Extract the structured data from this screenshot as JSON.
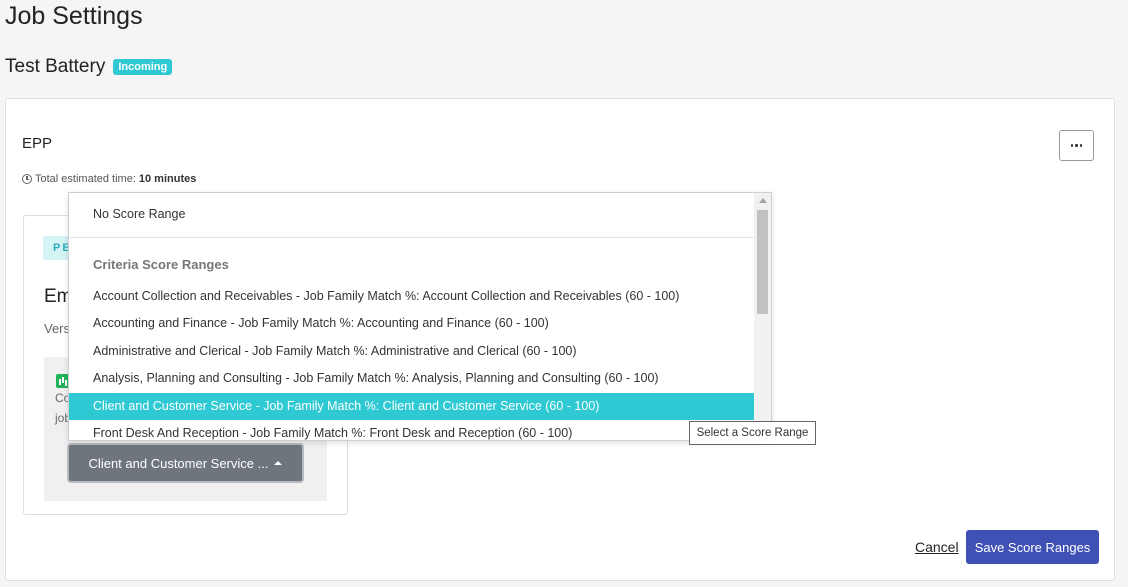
{
  "page": {
    "title": "Job Settings"
  },
  "battery": {
    "title": "Test Battery",
    "badge": "Incoming"
  },
  "assessment": {
    "name": "EPP",
    "time_label": "Total estimated time:",
    "time_value": "10 minutes",
    "more_icon": "ellipsis-icon"
  },
  "inner_card": {
    "badge": "PE",
    "title": "Em",
    "version": "Vers",
    "gray_line1": "Co",
    "gray_line2": "job",
    "range_button_label": "Client and Customer Service ..."
  },
  "dropdown": {
    "no_range": "No Score Range",
    "group_header": "Criteria Score Ranges",
    "items": [
      "Account Collection and Receivables - Job Family Match %: Account Collection and Receivables (60 - 100)",
      "Accounting and Finance - Job Family Match %: Accounting and Finance (60 - 100)",
      "Administrative and Clerical - Job Family Match %: Administrative and Clerical (60 - 100)",
      "Analysis, Planning and Consulting - Job Family Match %: Analysis, Planning and Consulting (60 - 100)",
      "Client and Customer Service - Job Family Match %: Client and Customer Service (60 - 100)",
      "Front Desk And Reception - Job Family Match %: Front Desk and Reception (60 - 100)"
    ],
    "selected_index": 4
  },
  "tooltip": "Select a Score Range",
  "actions": {
    "cancel": "Cancel",
    "save": "Save Score Ranges"
  },
  "colors": {
    "accent": "#2ec9d3",
    "primary": "#3f51b5",
    "button_gray": "#6e757c",
    "success": "#21b35a"
  }
}
